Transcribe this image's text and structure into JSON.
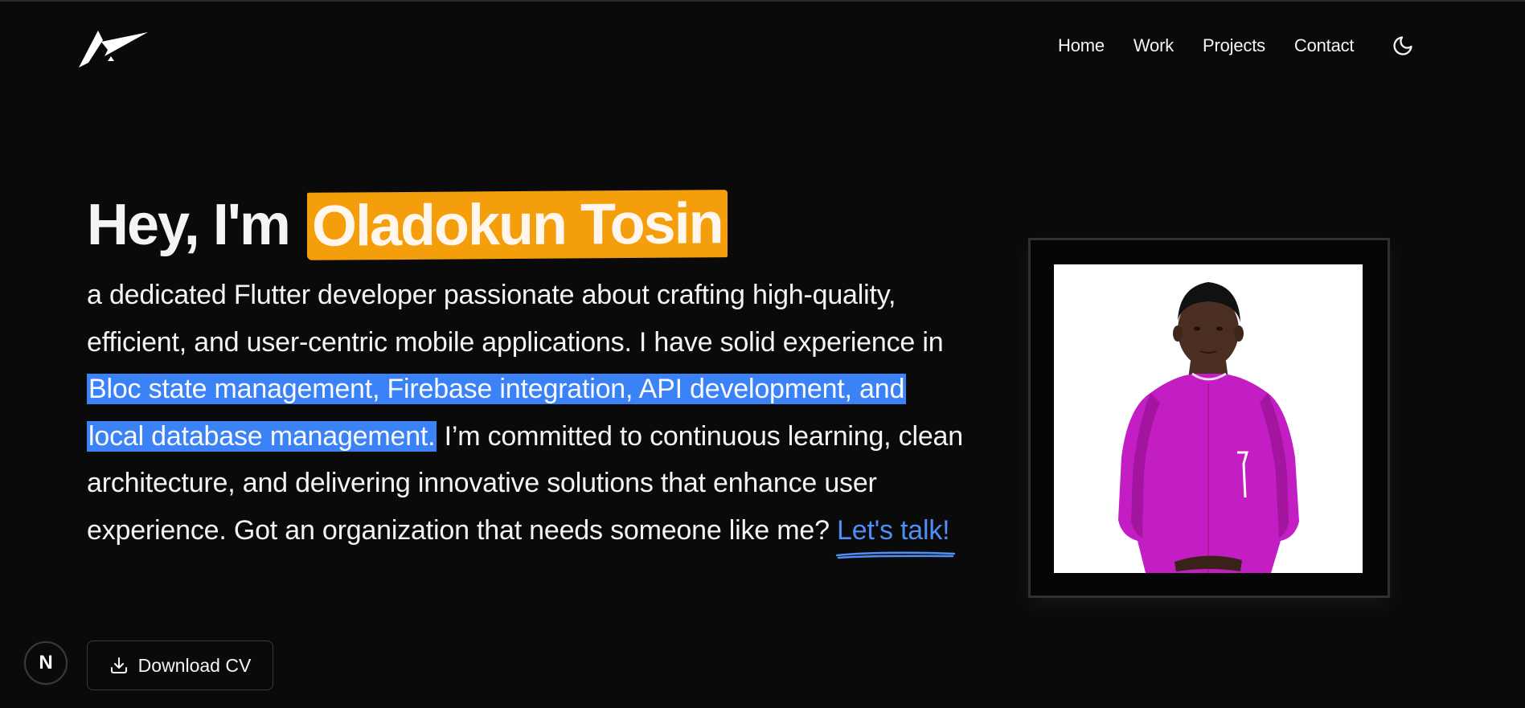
{
  "header": {
    "nav": [
      {
        "label": "Home"
      },
      {
        "label": "Work"
      },
      {
        "label": "Projects"
      },
      {
        "label": "Contact"
      }
    ],
    "theme_icon": "moon-icon",
    "logo_icon": "letter-a-logo"
  },
  "hero": {
    "greeting": "Hey, I'm ",
    "name": "Oladokun Tosin",
    "bio_start": "a dedicated Flutter developer passionate about crafting high-quality, efficient, and user-centric mobile applications. I have solid experience in ",
    "bio_highlight": "Bloc state management, Firebase integration, API development, and local database management.",
    "bio_end": " I’m committed to continuous learning, clean architecture, and delivering innovative solutions that enhance user experience. Got an organization that needs someone like me? ",
    "cta_link": "Let's talk!"
  },
  "actions": {
    "download_cv_label": "Download CV",
    "download_icon": "download-icon"
  },
  "badge": {
    "letter": "N"
  },
  "colors": {
    "background": "#0a0a0b",
    "name_highlight": "#f59e0b",
    "skills_highlight": "#3b82f6",
    "link": "#4f8ef7",
    "shirt": "#c21ec4"
  }
}
